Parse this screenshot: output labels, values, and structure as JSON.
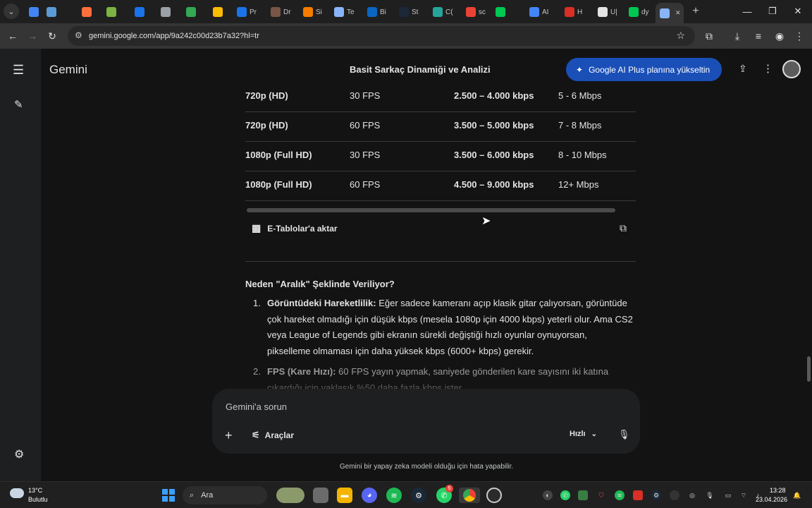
{
  "browser": {
    "tabs": [
      {
        "label": "",
        "color": "#4285f4"
      },
      {
        "label": "",
        "color": "#5b9bd5"
      },
      {
        "label": "",
        "color": "#ff6f3c"
      },
      {
        "label": "",
        "color": "#7cb342"
      },
      {
        "label": "",
        "color": "#1a73e8"
      },
      {
        "label": "",
        "color": "#9aa0a6"
      },
      {
        "label": "",
        "color": "#34a853"
      },
      {
        "label": "",
        "color": "#fbbc04"
      },
      {
        "label": "Pr",
        "color": "#1a73e8"
      },
      {
        "label": "Dr",
        "color": "#795548"
      },
      {
        "label": "Si",
        "color": "#f57c00"
      },
      {
        "label": "Te",
        "color": "#8ab4f8"
      },
      {
        "label": "Bi",
        "color": "#0a66c2"
      },
      {
        "label": "St",
        "color": "#1b2838"
      },
      {
        "label": "C(",
        "color": "#26a69a"
      },
      {
        "label": "sc",
        "color": "#ea4335"
      },
      {
        "label": "",
        "color": "#00c853"
      },
      {
        "label": "AI",
        "color": "#4285f4"
      },
      {
        "label": "H",
        "color": "#d93025"
      },
      {
        "label": "U|",
        "color": "#e3e3e3"
      },
      {
        "label": "dy",
        "color": "#00c853"
      },
      {
        "label": "",
        "color": "#8ab4f8"
      }
    ],
    "new_tab": "+",
    "url": "gemini.google.com/app/9a242c00d23b7a32?hl=tr"
  },
  "header": {
    "app_name": "Gemini",
    "chat_title": "Basit Sarkaç Dinamiği ve Analizi",
    "upgrade_label": "Google AI Plus planına yükseltin"
  },
  "table": {
    "rows": [
      {
        "resolution": "720p (HD)",
        "fps": "30 FPS",
        "bitrate": "2.500 – 4.000 kbps",
        "speed": "5 - 6 Mbps"
      },
      {
        "resolution": "720p (HD)",
        "fps": "60 FPS",
        "bitrate": "3.500 – 5.000 kbps",
        "speed": "7 - 8 Mbps"
      },
      {
        "resolution": "1080p (Full HD)",
        "fps": "30 FPS",
        "bitrate": "3.500 – 6.000 kbps",
        "speed": "8 - 10 Mbps"
      },
      {
        "resolution": "1080p (Full HD)",
        "fps": "60 FPS",
        "bitrate": "4.500 – 9.000 kbps",
        "speed": "12+ Mbps"
      }
    ],
    "export_label": "E-Tablolar'a aktar"
  },
  "answer": {
    "section_heading": "Neden \"Aralık\" Şeklinde Veriliyor?",
    "item1": {
      "number": "1.",
      "title": "Görüntüdeki Hareketlilik:",
      "line1": " Eğer sadece kameranı açıp klasik gitar çalıyorsan, görüntüde",
      "line2": "çok hareket olmadığı için düşük kbps (mesela 1080p için 4000 kbps) yeterli olur. Ama CS2",
      "line3": "veya League of Legends gibi ekranın sürekli değiştiği hızlı oyunlar oynuyorsan,",
      "line4": "pikselleme olmaması için daha yüksek kbps (6000+ kbps) gerekir."
    },
    "item2": {
      "number": "2.",
      "title": "FPS (Kare Hızı):",
      "line1": " 60 FPS yayın yapmak, saniyede gönderilen kare sayısını iki katına",
      "line2": "çıkardığı için yaklaşık %50 daha fazla kbps ister."
    }
  },
  "composer": {
    "placeholder": "Gemini'a sorun",
    "tools_label": "Araçlar",
    "mode_label": "Hızlı"
  },
  "disclaimer": "Gemini bir yapay zeka modeli olduğu için hata yapabilir.",
  "taskbar": {
    "weather_temp": "13°C",
    "weather_desc": "Bulutlu",
    "search_label": "Ara",
    "whatsapp_badge": "5",
    "time": "13:28",
    "date": "23.04.2026"
  },
  "colors": {
    "accent": "#1a4fb8",
    "background": "#131314",
    "sidebar": "#1e1f20",
    "taskbar": "#202020"
  }
}
